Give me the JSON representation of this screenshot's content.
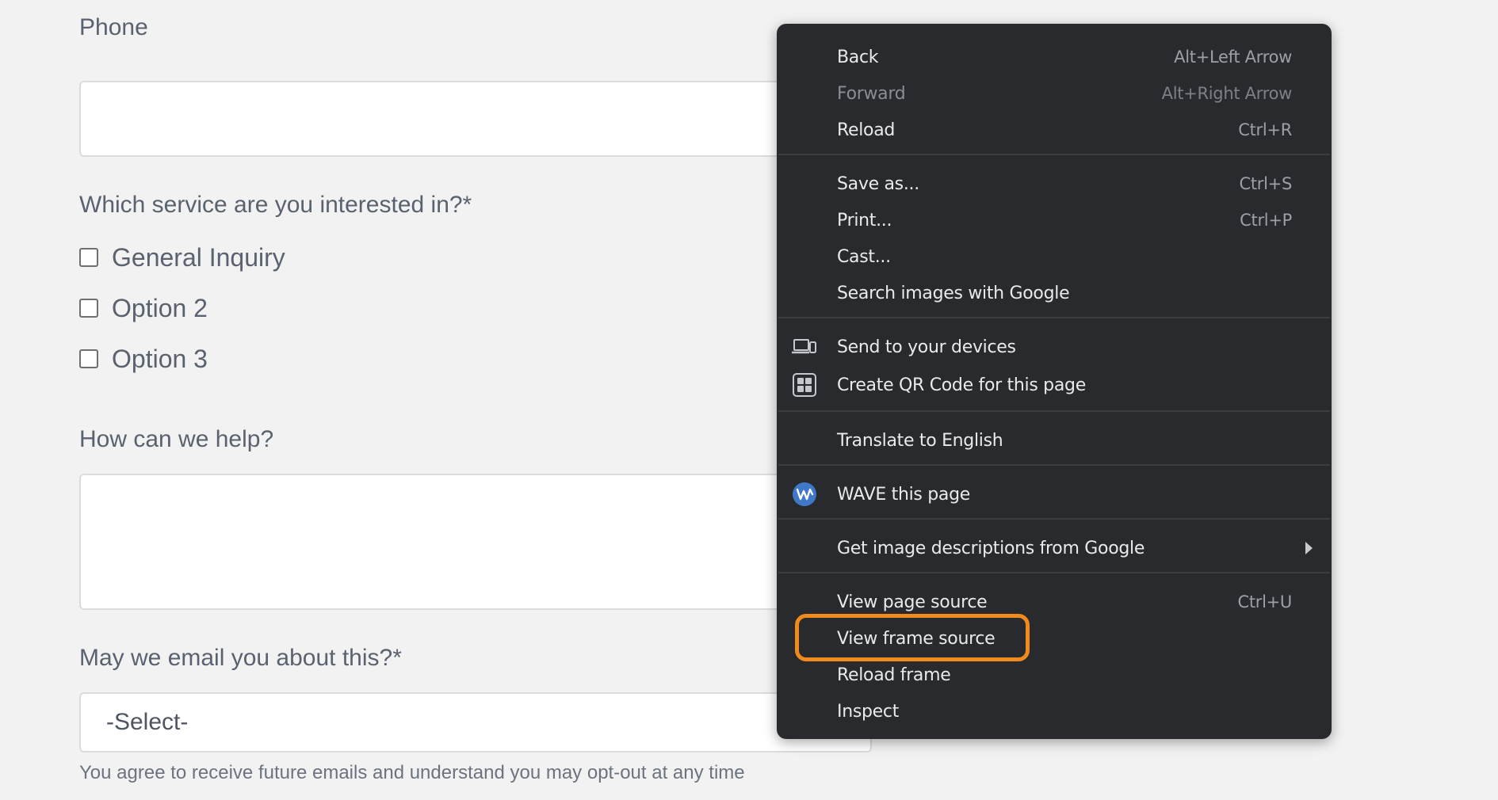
{
  "form": {
    "phone_label": "Phone",
    "service_label": "Which service are you interested in?*",
    "services": [
      "General Inquiry",
      "Option 2",
      "Option 3"
    ],
    "help_label": "How can we help?",
    "email_label": "May we email you about this?*",
    "email_select_value": "-Select-",
    "email_note": "You agree to receive future emails and understand you may opt-out at any time"
  },
  "context_menu": {
    "back": {
      "label": "Back",
      "shortcut": "Alt+Left Arrow"
    },
    "forward": {
      "label": "Forward",
      "shortcut": "Alt+Right Arrow"
    },
    "reload": {
      "label": "Reload",
      "shortcut": "Ctrl+R"
    },
    "save_as": {
      "label": "Save as...",
      "shortcut": "Ctrl+S"
    },
    "print": {
      "label": "Print...",
      "shortcut": "Ctrl+P"
    },
    "cast": {
      "label": "Cast..."
    },
    "search_images": {
      "label": "Search images with Google"
    },
    "send_to_devices": {
      "label": "Send to your devices",
      "icon": "devices-icon"
    },
    "create_qr": {
      "label": "Create QR Code for this page",
      "icon": "qr-code-icon"
    },
    "translate": {
      "label": "Translate to English"
    },
    "wave": {
      "label": "WAVE this page",
      "icon": "wave-extension-icon"
    },
    "image_descriptions": {
      "label": "Get image descriptions from Google"
    },
    "view_page_source": {
      "label": "View page source",
      "shortcut": "Ctrl+U"
    },
    "view_frame_source": {
      "label": "View frame source"
    },
    "reload_frame": {
      "label": "Reload frame"
    },
    "inspect": {
      "label": "Inspect"
    }
  },
  "colors": {
    "menu_background": "#292a2d",
    "highlight_outline": "#f08a1c",
    "wave_icon": "#3f77c9"
  }
}
